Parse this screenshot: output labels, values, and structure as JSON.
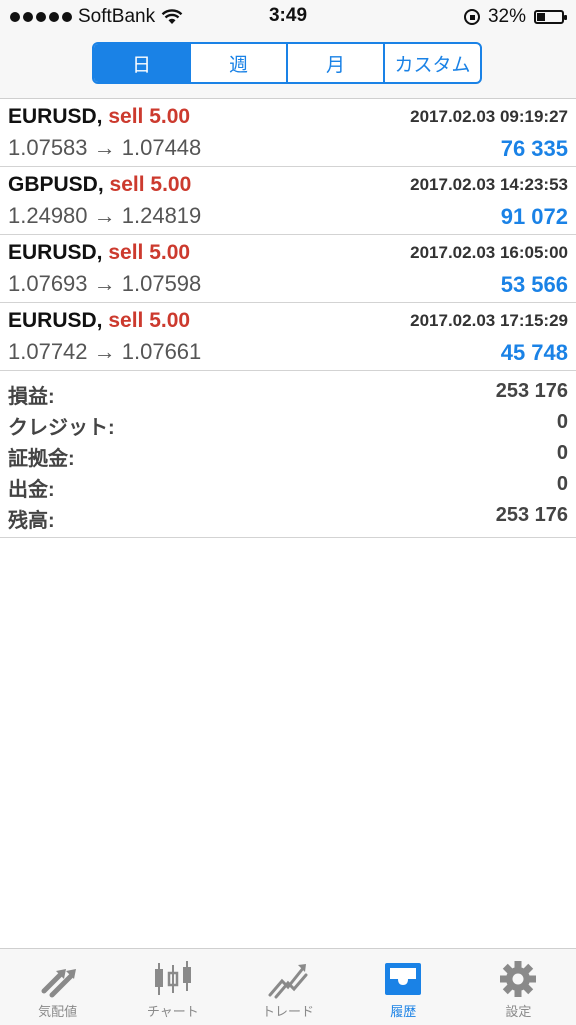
{
  "status": {
    "carrier": "SoftBank",
    "time": "3:49",
    "battery_text": "32%",
    "battery_level": 0.32
  },
  "periods": {
    "options": [
      "日",
      "週",
      "月",
      "カスタム"
    ],
    "selected": "日"
  },
  "trades": [
    {
      "symbol": "EURUSD,",
      "side": "sell 5.00",
      "datetime": "2017.02.03 09:19:27",
      "prices": "1.07583 → 1.07448",
      "profit": "76 335"
    },
    {
      "symbol": "GBPUSD,",
      "side": "sell 5.00",
      "datetime": "2017.02.03 14:23:53",
      "prices": "1.24980 → 1.24819",
      "profit": "91 072"
    },
    {
      "symbol": "EURUSD,",
      "side": "sell 5.00",
      "datetime": "2017.02.03 16:05:00",
      "prices": "1.07693 → 1.07598",
      "profit": "53 566"
    },
    {
      "symbol": "EURUSD,",
      "side": "sell 5.00",
      "datetime": "2017.02.03 17:15:29",
      "prices": "1.07742 → 1.07661",
      "profit": "45 748"
    }
  ],
  "summary": [
    {
      "label": "損益:",
      "value": "253 176"
    },
    {
      "label": "クレジット:",
      "value": "0"
    },
    {
      "label": "証拠金:",
      "value": "0"
    },
    {
      "label": "出金:",
      "value": "0"
    },
    {
      "label": "残高:",
      "value": "253 176"
    }
  ],
  "tabs": [
    {
      "label": "気配値",
      "icon": "quotes-arrows-icon"
    },
    {
      "label": "チャート",
      "icon": "candlestick-icon"
    },
    {
      "label": "トレード",
      "icon": "trade-trend-icon"
    },
    {
      "label": "履歴",
      "icon": "inbox-tray-icon"
    },
    {
      "label": "設定",
      "icon": "gear-icon"
    }
  ],
  "colors": {
    "accent": "#1a82e6",
    "sell": "#cc3a2e",
    "inactive": "#8a8a8a"
  }
}
